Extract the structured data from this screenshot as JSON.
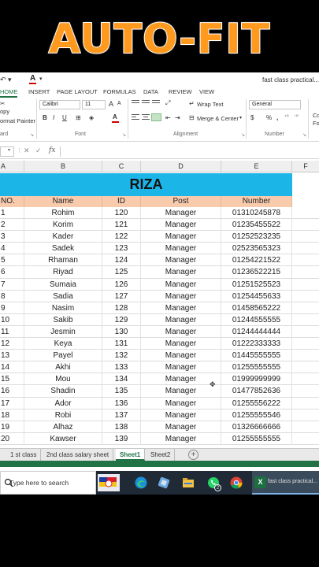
{
  "banner": {
    "title": "AUTO-FIT"
  },
  "titlebar": {
    "window_title": "fast class practical..."
  },
  "ribbon_tabs": [
    "HOME",
    "INSERT",
    "PAGE LAYOUT",
    "FORMULAS",
    "DATA",
    "REVIEW",
    "VIEW"
  ],
  "ribbon": {
    "clipboard": {
      "copy": "opy",
      "format_painter": "ormat Painter",
      "group_label": "ard"
    },
    "font": {
      "name": "Calibri",
      "size": "11",
      "grow": "A",
      "shrink": "A",
      "bold": "B",
      "italic": "I",
      "underline": "U",
      "font_color": "A",
      "group_label": "Font"
    },
    "alignment": {
      "wrap_text": "Wrap Text",
      "merge_center": "Merge & Center",
      "group_label": "Alignment"
    },
    "number": {
      "format": "General",
      "currency": "$",
      "percent": "%",
      "comma": ",",
      "group_label": "Number"
    },
    "styles": {
      "conditional": "Co",
      "format": "Fo"
    }
  },
  "formula_bar": {
    "cancel": "✕",
    "enter": "✓",
    "fx": "fx"
  },
  "columns": [
    "A",
    "B",
    "C",
    "D",
    "E",
    "F"
  ],
  "sheet": {
    "title": "RIZA",
    "headers": [
      "NO.",
      "Name",
      "ID",
      "Post",
      "Number"
    ],
    "rows": [
      [
        "1",
        "Rohim",
        "120",
        "Manager",
        "01310245878"
      ],
      [
        "2",
        "Korim",
        "121",
        "Manager",
        "01235455522"
      ],
      [
        "3",
        "Kader",
        "122",
        "Manager",
        "01252523235"
      ],
      [
        "4",
        "Sadek",
        "123",
        "Manager",
        "02523565323"
      ],
      [
        "5",
        "Rhaman",
        "124",
        "Manager",
        "01254221522"
      ],
      [
        "6",
        "Riyad",
        "125",
        "Manager",
        "01236522215"
      ],
      [
        "7",
        "Sumaia",
        "126",
        "Manager",
        "01251525523"
      ],
      [
        "8",
        "Sadia",
        "127",
        "Manager",
        "01254455633"
      ],
      [
        "9",
        "Nasim",
        "128",
        "Manager",
        "01458565222"
      ],
      [
        "10",
        "Sakib",
        "129",
        "Manager",
        "01244555555"
      ],
      [
        "11",
        "Jesmin",
        "130",
        "Manager",
        "01244444444"
      ],
      [
        "12",
        "Keya",
        "131",
        "Manager",
        "01222333333"
      ],
      [
        "13",
        "Payel",
        "132",
        "Manager",
        "01445555555"
      ],
      [
        "14",
        "Akhi",
        "133",
        "Manager",
        "01255555555"
      ],
      [
        "15",
        "Mou",
        "134",
        "Manager",
        "01999999999"
      ],
      [
        "16",
        "Shadin",
        "135",
        "Manager",
        "01477852636"
      ],
      [
        "17",
        "Ador",
        "136",
        "Manager",
        "01255556222"
      ],
      [
        "18",
        "Robi",
        "137",
        "Manager",
        "01255555546"
      ],
      [
        "19",
        "Alhaz",
        "138",
        "Manager",
        "01326666666"
      ],
      [
        "20",
        "Kawser",
        "139",
        "Manager",
        "01255555555"
      ]
    ]
  },
  "sheet_tabs": [
    "1 st class",
    "2nd class salary sheet",
    "Sheet1",
    "Sheet2"
  ],
  "add_sheet": "+",
  "taskbar": {
    "search_placeholder": "Type here to search",
    "whatsapp_badge": "2",
    "excel_label": "fast class practical...",
    "excel_glyph": "X"
  },
  "colors": {
    "excel_green": "#217346",
    "title_fill": "#1cb5e8",
    "header_fill": "#f8cbad",
    "banner_text": "#ff9a1f"
  }
}
